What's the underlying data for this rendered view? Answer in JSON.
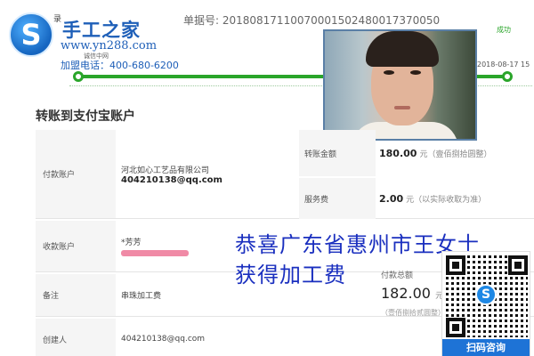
{
  "header": {
    "logo_small": "录",
    "logo_title": "手工之家",
    "logo_url": "www.yn288.com",
    "logo_tiny": "诚信中网",
    "phone": "加盟电话：400-680-6200",
    "order_no": "单据号: 20180817110070001502480017370050",
    "status": "成功",
    "date": "2018-08-17 15"
  },
  "page": {
    "section_title": "转账到支付宝账户"
  },
  "rows": {
    "payer_label": "付款账户",
    "payer_company": "河北如心工艺品有限公司",
    "payer_email": "404210138@qq.com",
    "payee_label": "收款账户",
    "payee_name": "*芳芳",
    "memo_label": "备注",
    "memo_value": "串珠加工费",
    "creator_label": "创建人",
    "creator_value": "404210138@qq.com"
  },
  "amounts": {
    "transfer_label": "转账金额",
    "transfer_value": "180.00",
    "transfer_unit": "元",
    "transfer_note": "（壹佰捌拾圆整）",
    "fee_label": "服务费",
    "fee_value": "2.00",
    "fee_unit": "元",
    "fee_note": "（以实际收取为准）",
    "total_label": "付款总额",
    "total_value": "182.00",
    "total_unit": "元",
    "total_note": "（壹佰捌拾贰圆整）"
  },
  "banner": {
    "line1": "恭喜广东省惠州市王女士",
    "line2": "获得加工费"
  },
  "qr": {
    "caption": "扫码咨询"
  },
  "colors": {
    "brand_blue": "#1e5fb8",
    "success_green": "#2aa52a",
    "banner_blue": "#1a2fbf",
    "redaction_pink": "#f08aa6"
  }
}
